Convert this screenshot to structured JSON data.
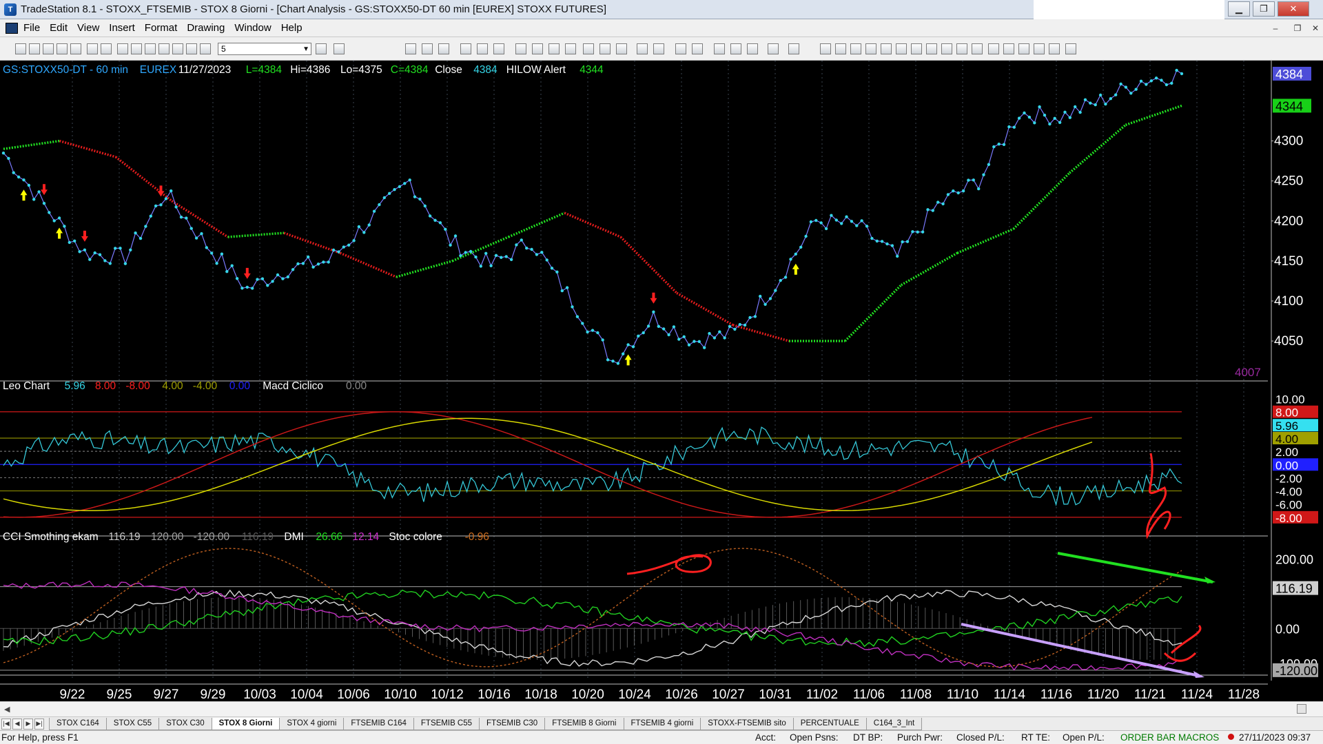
{
  "window": {
    "title": "TradeStation 8.1 - STOXX_FTSEMIB - STOX  8 Giorni - [Chart Analysis - GS:STOXX50-DT  60 min  [EUREX] STOXX FUTURES]",
    "minimize_label": "▁",
    "restore_label": "❐",
    "close_label": "✕"
  },
  "menu": {
    "items": [
      "File",
      "Edit",
      "View",
      "Insert",
      "Format",
      "Drawing",
      "Window",
      "Help"
    ],
    "mdi_controls": [
      "–",
      "❐",
      "✕"
    ]
  },
  "toolbar": {
    "interval_value": "5"
  },
  "chart_data": [
    {
      "type": "line",
      "panel": "price",
      "symbol": "GS:STOXX50-DT - 60 min",
      "exchange": "EUREX",
      "date": "11/27/2023",
      "ohlc": {
        "L": "L=4384",
        "Hi": "Hi=4386",
        "Lo": "Lo=4375",
        "C": "C=4384"
      },
      "close_label": "Close",
      "close_value": "4384",
      "indicator_name": "HILOW Alert",
      "indicator_value": "4344",
      "yticks": [
        "4300",
        "4250",
        "4200",
        "4150",
        "4100",
        "4050"
      ],
      "ylim": [
        4007,
        4390
      ],
      "last_price_tag": "4384",
      "hilow_tag": "4344",
      "low_label": "4007",
      "x": [
        "9/22",
        "9/25",
        "9/27",
        "9/29",
        "10/03",
        "10/04",
        "10/06",
        "10/10",
        "10/12",
        "10/16",
        "10/18",
        "10/20",
        "10/24",
        "10/26",
        "10/27",
        "10/31",
        "11/02",
        "11/06",
        "11/08",
        "11/10",
        "11/14",
        "11/16",
        "11/20",
        "11/21",
        "11/24"
      ],
      "series": [
        {
          "name": "Close",
          "color": "#35d6e8",
          "values": [
            4285,
            4220,
            4160,
            4155,
            4235,
            4170,
            4115,
            4140,
            4150,
            4200,
            4250,
            4175,
            4145,
            4175,
            4100,
            4025,
            4080,
            4050,
            4060,
            4120,
            4200,
            4195,
            4155,
            4220,
            4250,
            4335,
            4330,
            4350,
            4375,
            4384
          ]
        },
        {
          "name": "HILOW Alert",
          "values": [
            4290,
            4300,
            4280,
            4225,
            4180,
            4185,
            4160,
            4130,
            4150,
            4180,
            4210,
            4180,
            4110,
            4070,
            4050,
            4050,
            4120,
            4160,
            4190,
            4260,
            4320,
            4344
          ]
        }
      ],
      "x_axis_labels": [
        "9/22",
        "9/25",
        "9/27",
        "9/29",
        "10/03",
        "10/04",
        "10/06",
        "10/10",
        "10/12",
        "10/16",
        "10/18",
        "10/20",
        "10/24",
        "10/26",
        "10/27",
        "10/31",
        "11/02",
        "11/06",
        "11/08",
        "11/10",
        "11/14",
        "11/16",
        "11/20",
        "11/21",
        "11/24",
        "11/28"
      ],
      "colors": {
        "rising": "#21e021",
        "falling": "#e01c1c",
        "up_arrow": "#ffff00",
        "down_arrow": "#ff2020"
      }
    },
    {
      "type": "line",
      "panel": "leo",
      "name": "Leo Chart",
      "values": [
        "5.96",
        "8.00",
        "-8.00",
        "4.00",
        "-4.00",
        "0.00"
      ],
      "value_colors": [
        "#35d6e8",
        "#ff2020",
        "#ff2020",
        "#a0a000",
        "#a0a000",
        "#2020ff"
      ],
      "indicator2_name": "Macd Ciclico",
      "indicator2_value": "0.00",
      "yticks": [
        "10.00",
        "8.00",
        "5.96",
        "4.00",
        "2.00",
        "0.00",
        "-2.00",
        "-4.00",
        "-6.00",
        "-8.00"
      ],
      "ylim": [
        -10,
        11
      ]
    },
    {
      "type": "line",
      "panel": "cci",
      "name": "CCI Smothing ekam",
      "values": [
        "116.19",
        "120.00",
        "-120.00",
        "116.19"
      ],
      "value_colors": [
        "#c8c8c8",
        "#a0a0a0",
        "#a0a0a0",
        "#5a5a5a"
      ],
      "dmi_label": "DMI",
      "dmi_values": [
        "26.66",
        "12.14"
      ],
      "dmi_colors": [
        "#21e021",
        "#d030d0"
      ],
      "stoc_label": "Stoc colore",
      "stoc_value": "-0.96",
      "yticks": [
        "200.00",
        "116.19",
        "0.00",
        "-100.00",
        "-120.00"
      ],
      "ylim": [
        -150,
        250
      ]
    }
  ],
  "tabs": [
    "STOX C164",
    "STOX C55",
    "STOX  C30",
    "STOX  8 Giorni",
    "STOX 4 giorni",
    "FTSEMIB C164",
    "FTSEMIB C55",
    "FTSEMIB C30",
    "FTSEMIB  8 Giorni",
    "FTSEMIB  4 giorni",
    "STOXX-FTSEMIB sito",
    "PERCENTUALE",
    "C164_3_Int"
  ],
  "active_tab": "STOX  8 Giorni",
  "status": {
    "help": "For Help, press F1",
    "acct": "Acct:",
    "open_psns": "Open Psns:",
    "dt_bp": "DT BP:",
    "purch_pwr": "Purch Pwr:",
    "closed_pl": "Closed P/L:",
    "rt_te": "RT TE:",
    "open_pl": "Open P/L:",
    "macros": "ORDER BAR  MACROS",
    "datetime": "27/11/2023 09:37"
  }
}
